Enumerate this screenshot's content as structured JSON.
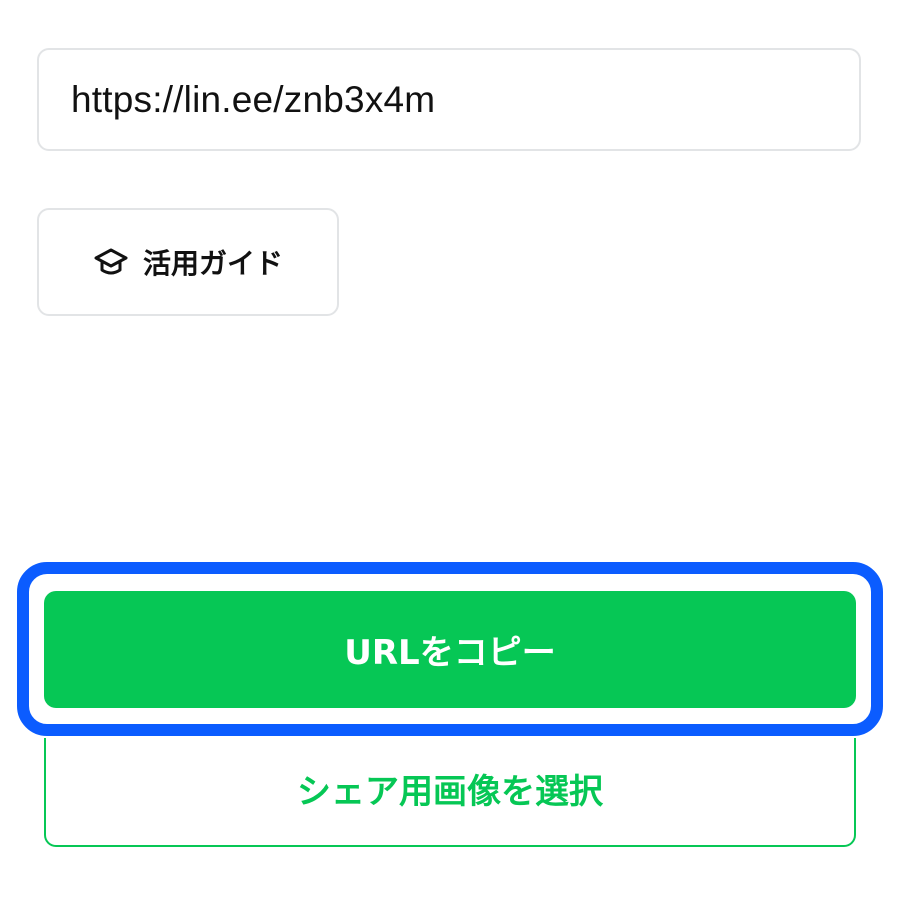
{
  "url_field": {
    "value": "https://lin.ee/znb3x4m"
  },
  "guide_button": {
    "label": "活用ガイド",
    "icon": "graduation-cap-icon"
  },
  "copy_button": {
    "label": "URLをコピー"
  },
  "share_image_button": {
    "label": "シェア用画像を選択"
  },
  "colors": {
    "brand_green": "#06c755",
    "highlight_blue": "#0b5cff",
    "field_border": "#e2e4e6"
  }
}
